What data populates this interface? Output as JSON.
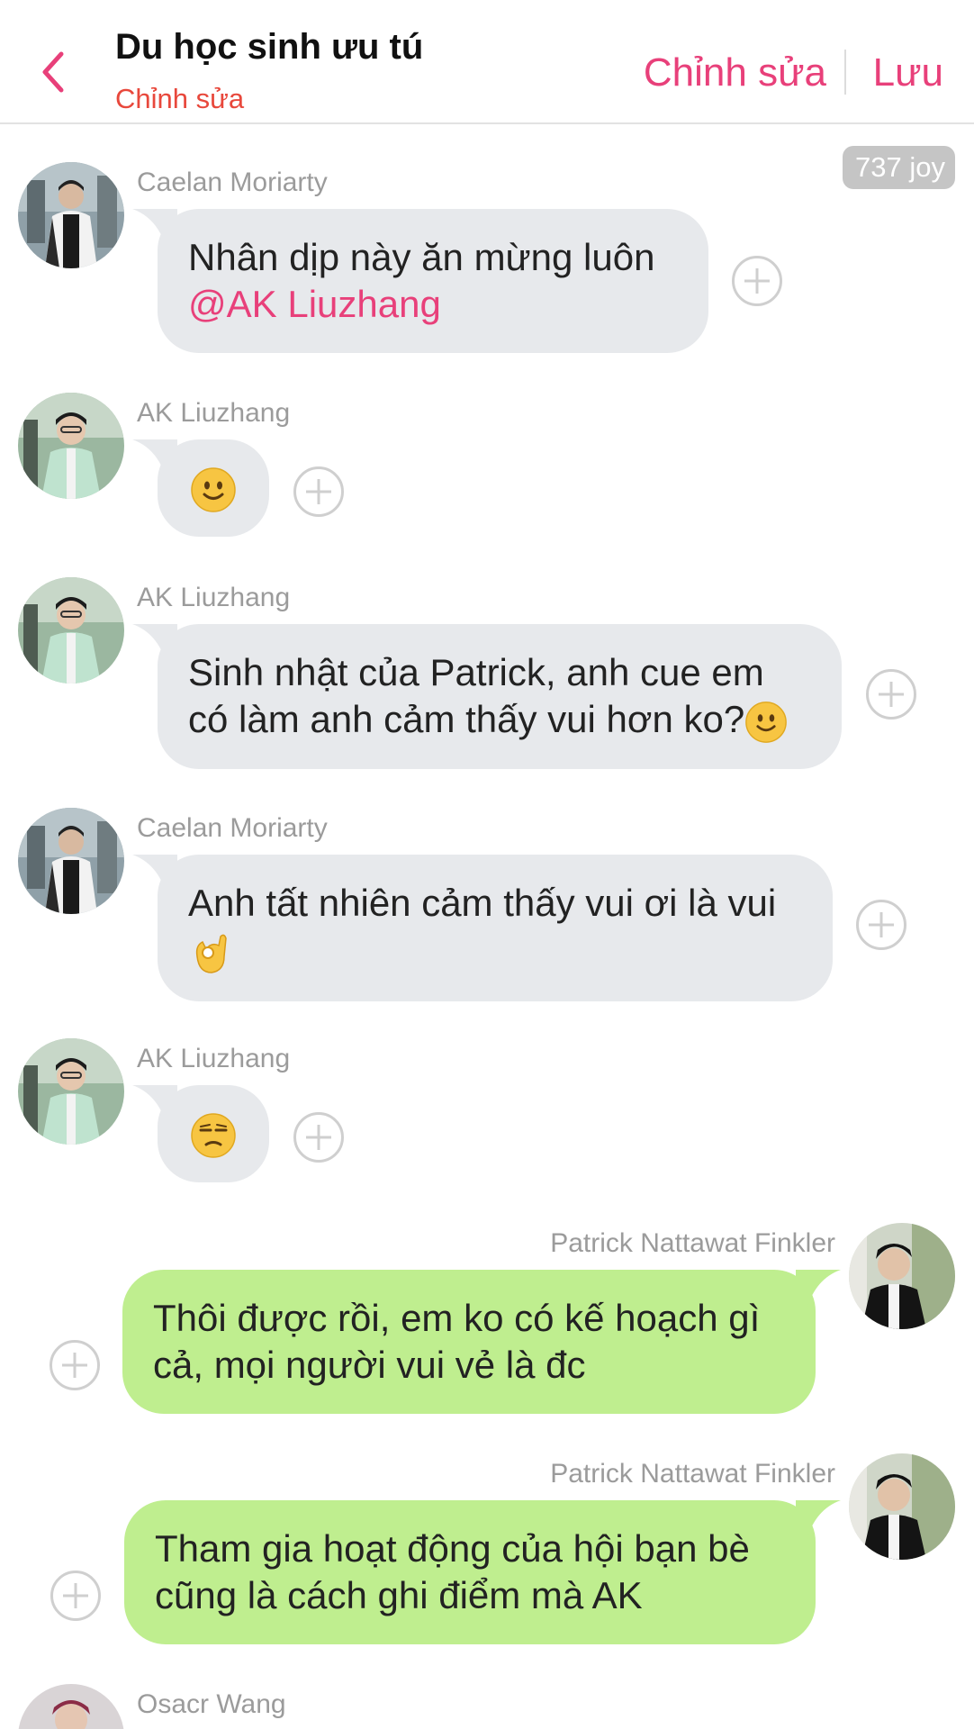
{
  "header": {
    "title": "Du học sinh ưu tú",
    "subtitle": "Chỉnh sửa",
    "edit_label": "Chỉnh sửa",
    "save_label": "Lưu",
    "back_icon": "chevron-left-icon"
  },
  "badge": "737 joy",
  "colors": {
    "accent": "#e8407a",
    "subtitle": "#e8483c",
    "incoming_bubble": "#e7e9ec",
    "outgoing_bubble": "#bfee8f",
    "sender_name": "#9b9b9b"
  },
  "messages": [
    {
      "sender": "Caelan Moriarty",
      "side": "left",
      "line1": "Nhân dịp này ăn mừng luôn",
      "mention": "@AK Liuzhang"
    },
    {
      "sender": "AK Liuzhang",
      "side": "left",
      "emoji": "slightly-smiling-face-emoji"
    },
    {
      "sender": "AK Liuzhang",
      "side": "left",
      "line1": "Sinh nhật của Patrick, anh cue em",
      "line2": "có làm anh cảm thấy vui hơn ko?",
      "emoji": "slightly-smiling-face-emoji"
    },
    {
      "sender": "Caelan Moriarty",
      "side": "left",
      "line1": "Anh tất nhiên cảm thấy vui ơi là vui",
      "emoji": "ok-hand-emoji"
    },
    {
      "sender": "AK Liuzhang",
      "side": "left",
      "emoji": "unamused-face-emoji"
    },
    {
      "sender": "Patrick Nattawat Finkler",
      "side": "right",
      "line1": "Thôi được rồi, em ko có kế hoạch gì",
      "line2": "cả, mọi người vui vẻ là đc"
    },
    {
      "sender": "Patrick Nattawat Finkler",
      "side": "right",
      "line1": "Tham gia hoạt động của hội bạn bè",
      "line2": "cũng là cách ghi điểm mà AK"
    },
    {
      "sender": "Osacr Wang",
      "side": "left"
    }
  ]
}
